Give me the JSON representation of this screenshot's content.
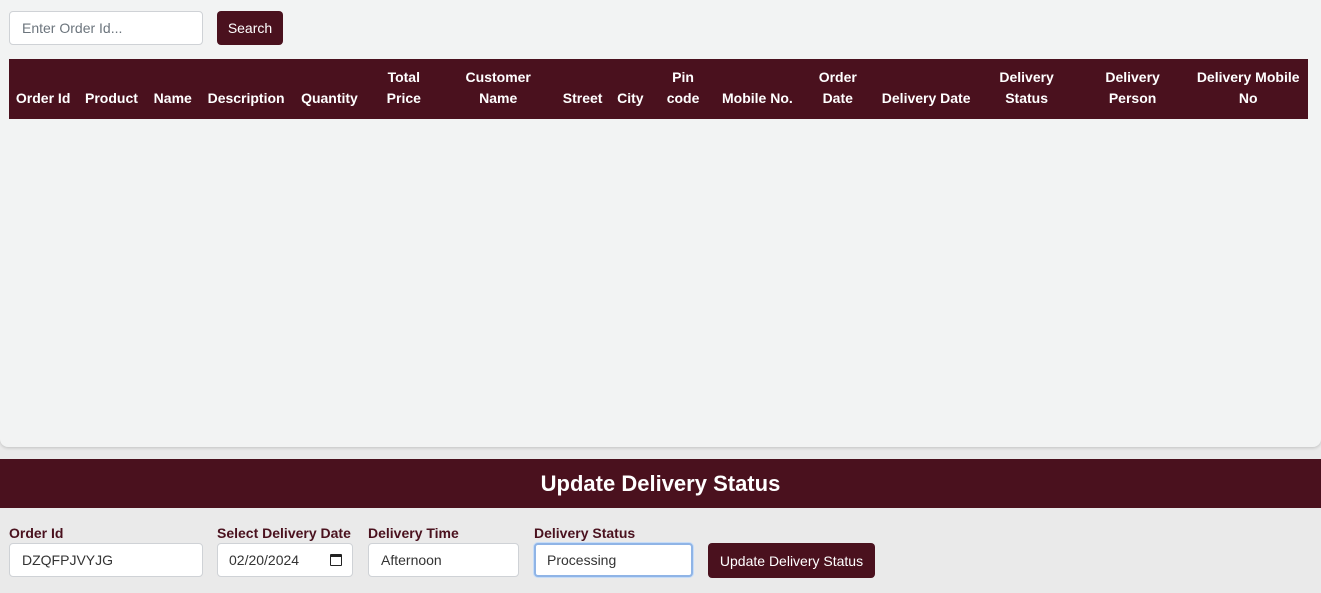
{
  "search": {
    "placeholder": "Enter Order Id...",
    "button_label": "Search"
  },
  "table": {
    "columns": [
      "Order Id",
      "Product",
      "Name",
      "Description",
      "Quantity",
      "Total Price",
      "Customer Name",
      "Street",
      "City",
      "Pin code",
      "Mobile No.",
      "Order Date",
      "Delivery Date",
      "Delivery Status",
      "Delivery Person",
      "Delivery Mobile No"
    ],
    "rows": []
  },
  "update_panel": {
    "title": "Update Delivery Status",
    "order_id_label": "Order Id",
    "order_id_value": "DZQFPJVYJG",
    "delivery_date_label": "Select Delivery Date",
    "delivery_date_value": "02/20/2024",
    "delivery_time_label": "Delivery Time",
    "delivery_time_value": "Afternoon",
    "delivery_status_label": "Delivery Status",
    "delivery_status_value": "Processing",
    "submit_label": "Update Delivery Status"
  },
  "colors": {
    "brand": "#4a111e",
    "page_bg": "#f2f3f3",
    "focus_ring": "#8fb4e6"
  }
}
